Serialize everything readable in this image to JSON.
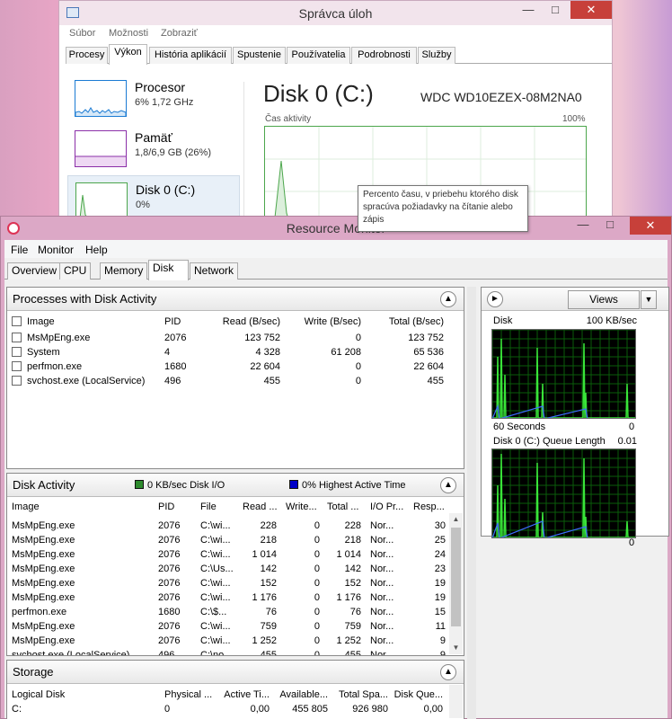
{
  "task_manager": {
    "title": "Správca úloh",
    "menu": [
      "Súbor",
      "Možnosti",
      "Zobraziť"
    ],
    "tabs": [
      "Procesy",
      "Výkon",
      "História aplikácií",
      "Spustenie",
      "Používatelia",
      "Podrobnosti",
      "Služby"
    ],
    "active_tab": "Výkon",
    "perf_items": [
      {
        "name": "Procesor",
        "value": "6%  1,72 GHz",
        "color": "#1b7bd3"
      },
      {
        "name": "Pamäť",
        "value": "1,8/6,9 GB (26%)",
        "color": "#8b2fa8"
      },
      {
        "name": "Disk 0 (C:)",
        "value": "0%",
        "color": "#4ca64c"
      }
    ],
    "detail": {
      "title": "Disk 0 (C:)",
      "model": "WDC WD10EZEX-08M2NA0",
      "graph_label": "Čas aktivity",
      "graph_max": "100%"
    },
    "tooltip": "Percento času, v priebehu ktorého disk spracúva požiadavky na čítanie alebo zápis"
  },
  "resource_monitor": {
    "title": "Resource Monitor",
    "menu": [
      "File",
      "Monitor",
      "Help"
    ],
    "tabs": [
      "Overview",
      "CPU",
      "Memory",
      "Disk",
      "Network"
    ],
    "active_tab": "Disk",
    "processes": {
      "title": "Processes with Disk Activity",
      "headers": [
        "Image",
        "PID",
        "Read (B/sec)",
        "Write (B/sec)",
        "Total (B/sec)"
      ],
      "rows": [
        [
          "MsMpEng.exe",
          "2076",
          "123 752",
          "0",
          "123 752"
        ],
        [
          "System",
          "4",
          "4 328",
          "61 208",
          "65 536"
        ],
        [
          "perfmon.exe",
          "1680",
          "22 604",
          "0",
          "22 604"
        ],
        [
          "svchost.exe (LocalService)",
          "496",
          "455",
          "0",
          "455"
        ]
      ]
    },
    "disk_activity": {
      "title": "Disk Activity",
      "io_legend": "0 KB/sec Disk I/O",
      "active_legend": "0% Highest Active Time",
      "io_color": "#2e8b2e",
      "active_color": "#0000c8",
      "headers": [
        "Image",
        "PID",
        "File",
        "Read ...",
        "Write...",
        "Total ...",
        "I/O Pr...",
        "Resp..."
      ],
      "rows": [
        [
          "MsMpEng.exe",
          "2076",
          "C:\\wi...",
          "228",
          "0",
          "228",
          "Nor...",
          "30"
        ],
        [
          "MsMpEng.exe",
          "2076",
          "C:\\wi...",
          "218",
          "0",
          "218",
          "Nor...",
          "25"
        ],
        [
          "MsMpEng.exe",
          "2076",
          "C:\\wi...",
          "1 014",
          "0",
          "1 014",
          "Nor...",
          "24"
        ],
        [
          "MsMpEng.exe",
          "2076",
          "C:\\Us...",
          "142",
          "0",
          "142",
          "Nor...",
          "23"
        ],
        [
          "MsMpEng.exe",
          "2076",
          "C:\\wi...",
          "152",
          "0",
          "152",
          "Nor...",
          "19"
        ],
        [
          "MsMpEng.exe",
          "2076",
          "C:\\wi...",
          "1 176",
          "0",
          "1 176",
          "Nor...",
          "19"
        ],
        [
          "perfmon.exe",
          "1680",
          "C:\\$...",
          "76",
          "0",
          "76",
          "Nor...",
          "15"
        ],
        [
          "MsMpEng.exe",
          "2076",
          "C:\\wi...",
          "759",
          "0",
          "759",
          "Nor...",
          "11"
        ],
        [
          "MsMpEng.exe",
          "2076",
          "C:\\wi...",
          "1 252",
          "0",
          "1 252",
          "Nor...",
          "9"
        ],
        [
          "svchost.exe (LocalService)",
          "496",
          "C:\\no...",
          "455",
          "0",
          "455",
          "Nor...",
          "9"
        ]
      ]
    },
    "storage": {
      "title": "Storage",
      "headers": [
        "Logical Disk",
        "Physical ...",
        "Active Ti...",
        "Available...",
        "Total Spa...",
        "Disk Que..."
      ],
      "rows": [
        [
          "C:",
          "0",
          "0,00",
          "455 805",
          "926 980",
          "0,00"
        ]
      ]
    },
    "right_pane": {
      "views_label": "Views",
      "graph1": {
        "label": "Disk",
        "max": "100 KB/sec",
        "time": "60 Seconds",
        "min": "0"
      },
      "graph2": {
        "label": "Disk 0 (C:) Queue Length",
        "max": "0.01",
        "min": "0"
      }
    }
  }
}
